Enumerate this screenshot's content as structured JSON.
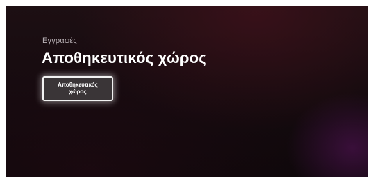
{
  "header": {
    "category": "Εγγραφές",
    "title": "Αποθηκευτικός χώρος"
  },
  "tiles": [
    {
      "label": "Αποθηκευτικός χώρος",
      "focused": true
    }
  ],
  "colors": {
    "background": "#150b0f",
    "focus_border": "#f2f2f2",
    "tile_fill": "#3a3537",
    "category_text": "#b9b2b6",
    "title_text": "#ffffff"
  }
}
